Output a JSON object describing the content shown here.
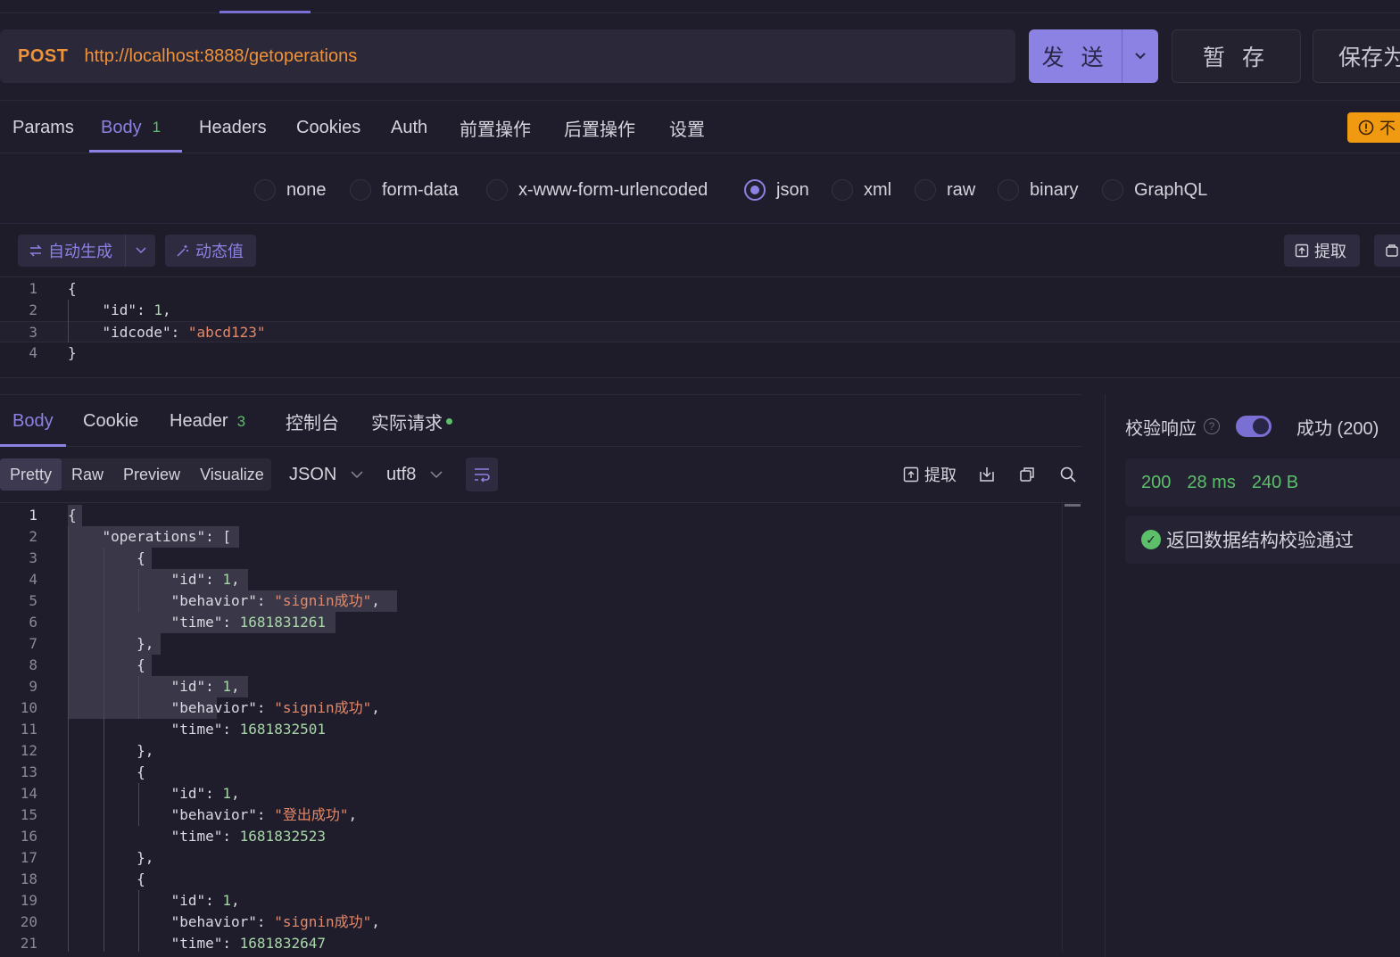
{
  "request": {
    "method": "POST",
    "url": "http://localhost:8888/getoperations",
    "send_label": "发 送",
    "save_label": "暂 存",
    "save_as_label": "保存为"
  },
  "req_tabs": [
    {
      "label": "Params"
    },
    {
      "label": "Body",
      "badge": "1"
    },
    {
      "label": "Headers"
    },
    {
      "label": "Cookies"
    },
    {
      "label": "Auth"
    },
    {
      "label": "前置操作"
    },
    {
      "label": "后置操作"
    },
    {
      "label": "设置"
    }
  ],
  "warn_label": "不",
  "body_types": [
    "none",
    "form-data",
    "x-www-form-urlencoded",
    "json",
    "xml",
    "raw",
    "binary",
    "GraphQL"
  ],
  "body_type_selected": "json",
  "editor_toolbar": {
    "autogen": "自动生成",
    "dynamic": "动态值",
    "extract": "提取"
  },
  "request_body_lines": [
    {
      "no": "1",
      "text": "{"
    },
    {
      "no": "2",
      "key": "\"id\"",
      "num": "1",
      "tail": ","
    },
    {
      "no": "3",
      "key": "\"idcode\"",
      "str": "\"abcd123\"",
      "tail": ""
    },
    {
      "no": "4",
      "text": "}"
    }
  ],
  "resp_tabs": [
    {
      "label": "Body"
    },
    {
      "label": "Cookie"
    },
    {
      "label": "Header",
      "badge": "3"
    },
    {
      "label": "控制台"
    },
    {
      "label": "实际请求"
    }
  ],
  "view_modes": [
    "Pretty",
    "Raw",
    "Preview",
    "Visualize"
  ],
  "view_selected": "Pretty",
  "format": "JSON",
  "encoding": "utf8",
  "resp_extract": "提取",
  "response_lines": [
    {
      "no": "1",
      "indent": 0,
      "text": "{"
    },
    {
      "no": "2",
      "indent": 1,
      "key": "\"operations\"",
      "tail": ": ["
    },
    {
      "no": "3",
      "indent": 2,
      "text": "{"
    },
    {
      "no": "4",
      "indent": 3,
      "key": "\"id\"",
      "num": "1",
      "tail": ","
    },
    {
      "no": "5",
      "indent": 3,
      "key": "\"behavior\"",
      "str": "\"signin成功\"",
      "tail": ","
    },
    {
      "no": "6",
      "indent": 3,
      "key": "\"time\"",
      "num": "1681831261",
      "tail": ""
    },
    {
      "no": "7",
      "indent": 2,
      "text": "},"
    },
    {
      "no": "8",
      "indent": 2,
      "text": "{"
    },
    {
      "no": "9",
      "indent": 3,
      "key": "\"id\"",
      "num": "1",
      "tail": ","
    },
    {
      "no": "10",
      "indent": 3,
      "key": "\"behavior\"",
      "str": "\"signin成功\"",
      "tail": ","
    },
    {
      "no": "11",
      "indent": 3,
      "key": "\"time\"",
      "num": "1681832501",
      "tail": ""
    },
    {
      "no": "12",
      "indent": 2,
      "text": "},"
    },
    {
      "no": "13",
      "indent": 2,
      "text": "{"
    },
    {
      "no": "14",
      "indent": 3,
      "key": "\"id\"",
      "num": "1",
      "tail": ","
    },
    {
      "no": "15",
      "indent": 3,
      "key": "\"behavior\"",
      "str": "\"登出成功\"",
      "tail": ","
    },
    {
      "no": "16",
      "indent": 3,
      "key": "\"time\"",
      "num": "1681832523",
      "tail": ""
    },
    {
      "no": "17",
      "indent": 2,
      "text": "},"
    },
    {
      "no": "18",
      "indent": 2,
      "text": "{"
    },
    {
      "no": "19",
      "indent": 3,
      "key": "\"id\"",
      "num": "1",
      "tail": ","
    },
    {
      "no": "20",
      "indent": 3,
      "key": "\"behavior\"",
      "str": "\"signin成功\"",
      "tail": ","
    },
    {
      "no": "21",
      "indent": 3,
      "key": "\"time\"",
      "num": "1681832647",
      "tail": ""
    }
  ],
  "verify": {
    "label": "校验响应",
    "enabled": true,
    "status": "成功 (200)",
    "code": "200",
    "time": "28 ms",
    "size": "240 B",
    "result": "返回数据结构校验通过"
  }
}
